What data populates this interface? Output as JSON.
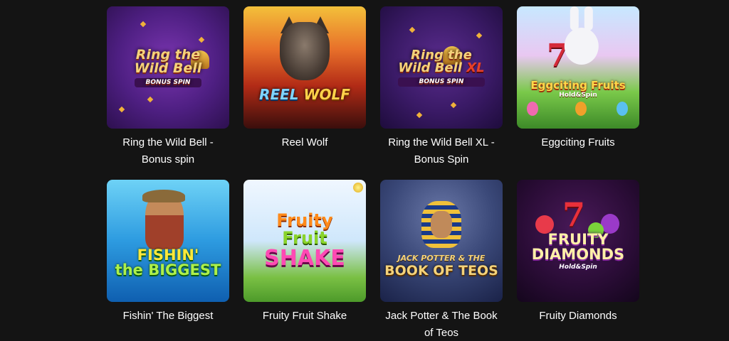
{
  "games": [
    {
      "title": "Ring the Wild Bell - Bonus spin",
      "logo": {
        "line1": "Ring the",
        "line2": "Wild Bell",
        "sub": "BONUS SPIN"
      }
    },
    {
      "title": "Reel Wolf",
      "logo": {
        "line1": "REEL",
        "line2": "WOLF"
      }
    },
    {
      "title": "Ring the Wild Bell XL - Bonus Spin",
      "logo": {
        "line1": "Ring the",
        "line2": "Wild Bell",
        "xl": "XL",
        "sub": "BONUS SPIN"
      }
    },
    {
      "title": "Eggciting Fruits",
      "logo": {
        "line1": "Eggciting Fruits",
        "sub": "Hold&Spin"
      }
    },
    {
      "title": "Fishin' The Biggest",
      "logo": {
        "line1": "FISHIN'",
        "line2": "the BIGGEST"
      }
    },
    {
      "title": "Fruity Fruit Shake",
      "logo": {
        "line1": "Fruity",
        "line2": "Fruit",
        "line3": "SHAKE"
      }
    },
    {
      "title": "Jack Potter & The Book of Teos",
      "logo": {
        "line1": "JACK POTTER & THE",
        "line2": "BOOK OF TEOS"
      }
    },
    {
      "title": "Fruity Diamonds",
      "logo": {
        "line1": "FRUITY",
        "line2": "DIAMONDS",
        "sub": "Hold&Spin"
      }
    }
  ],
  "colors": {
    "background": "#141414",
    "text": "#ffffff"
  }
}
